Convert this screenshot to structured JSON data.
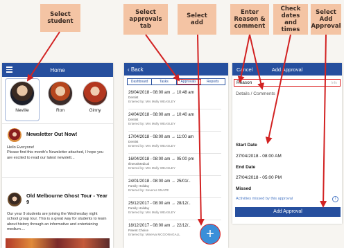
{
  "callouts": {
    "select_student": "Select\nstudent",
    "select_approvals_tab": "Select\napprovals\ntab",
    "select_add": "Select\nadd",
    "enter_reason": "Enter\nReason &\ncomment",
    "check_dates": "Check\ndates and\ntimes",
    "select_add_approval": "Select\nAdd\nApproval"
  },
  "home": {
    "title": "Home",
    "students": [
      "Neville",
      "Ron",
      "Ginny"
    ],
    "news": [
      {
        "title": "Newsletter Out Now!",
        "body": "Hello Everyone!\nPlease find this month's Newsletter attached, I hope you are excited to read our latest newslett..."
      },
      {
        "title": "Old Melbourne Ghost Tour - Year 9",
        "body": "Our year 9 students are joining the Wednesday night school group tour. This is a great way for students to learn about history through an informative and entertaining medium...."
      }
    ]
  },
  "approvals": {
    "back_label": "Back",
    "tabs": [
      "Dashboard",
      "Tasks",
      "Approvals",
      "Reports"
    ],
    "active_tab": "Approvals",
    "items": [
      {
        "date": "26/04/2018 - 08:00 am → 10:48 am",
        "reason": "Dentist",
        "entered": "Entered by: Mrs Molly WEASLEY"
      },
      {
        "date": "24/04/2018 - 08:00 am → 10:40 am",
        "reason": "Dentist",
        "entered": "Entered by: Mrs Molly WEASLEY"
      },
      {
        "date": "17/04/2018 - 08:00 am → 11:00 am",
        "reason": "Dentist",
        "entered": "Entered by: Mrs Molly WEASLEY"
      },
      {
        "date": "16/04/2018 - 08:00 am → 05:00 pm",
        "reason": "Illness/Medical",
        "entered": "Entered by: Mrs Molly WEASLEY"
      },
      {
        "date": "24/01/2018 - 08:00 am → 25/01/..",
        "reason": "Family Holiday",
        "entered": "Entered by: Severus SNAPE"
      },
      {
        "date": "25/12/2017 - 08:00 am → 28/12/..",
        "reason": "Family Holiday",
        "entered": "Entered by: Mrs Molly WEASLEY"
      },
      {
        "date": "18/12/2017 - 08:00 am → 22/12/..",
        "reason": "Parent Choice",
        "entered": "Entered by: Minerva MCGONAGALL"
      }
    ],
    "fab_symbol": "+"
  },
  "add_approval": {
    "cancel_label": "Cancel",
    "title": "Add Approval",
    "reason_label": "Reason",
    "reason_hint": "Info",
    "details_label": "Details / Comments",
    "start_date_label": "Start Date",
    "start_date_value": "27/04/2018 - 08:00 AM",
    "end_date_label": "End Date",
    "end_date_value": "27/04/2018 - 05:00 PM",
    "missed_label": "Missed",
    "missed_link": "Activities missed by this approval",
    "info_glyph": "i",
    "button_label": "Add Approval"
  },
  "colors": {
    "brand_blue": "#264f9e",
    "fab_blue": "#3b8fd9",
    "arrow_red": "#d22222",
    "callout_peach": "#f4c4a4"
  }
}
